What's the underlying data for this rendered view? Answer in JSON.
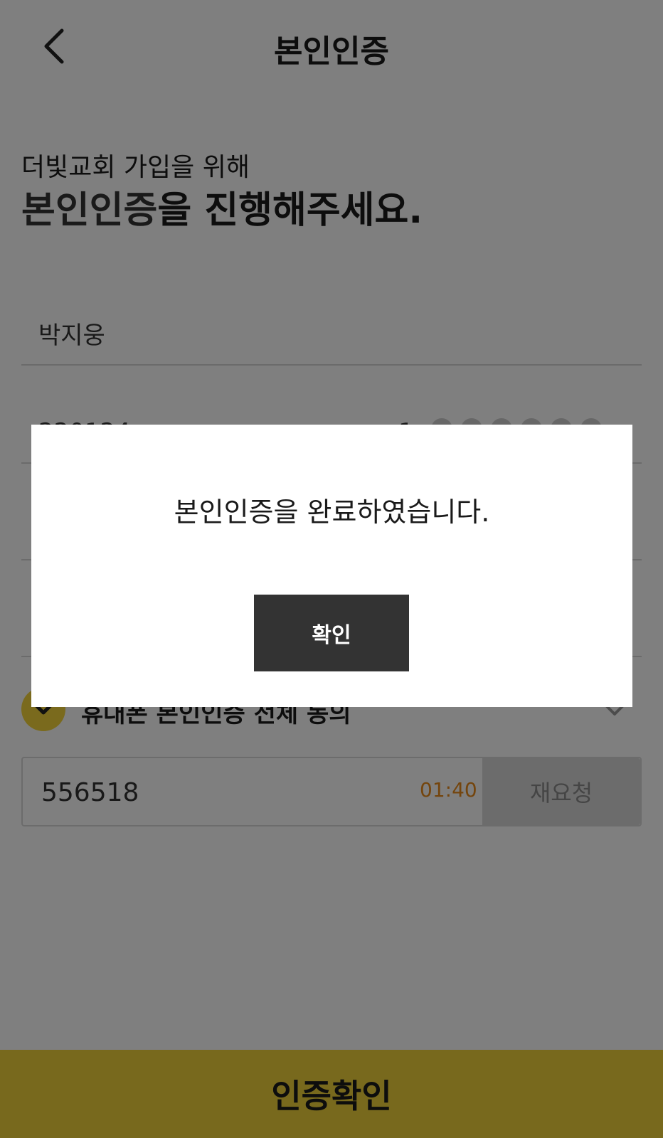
{
  "header": {
    "title": "본인인증",
    "back_icon": "chevron-left-icon"
  },
  "intro": {
    "subtitle": "더빛교회 가입을 위해",
    "title_highlight": "본인인증",
    "title_rest": "을 진행해주세요."
  },
  "form": {
    "name_value": "박지웅",
    "id_front_value": "220124",
    "id_gender_digit": "1",
    "masked_dot_count": 6
  },
  "agreement": {
    "label": "휴대폰 본인인증 전체 동의",
    "check_icon": "checkmark-icon",
    "expand_icon": "chevron-down-icon",
    "accent_color": "#f5d43a"
  },
  "verification": {
    "code_value": "556518",
    "timer": "01:40",
    "resend_label": "재요청",
    "timer_color": "#e88a1a"
  },
  "bottom_button": {
    "label": "인증확인",
    "color": "#f0d33a"
  },
  "modal": {
    "message": "본인인증을 완료하였습니다.",
    "confirm_label": "확인"
  }
}
